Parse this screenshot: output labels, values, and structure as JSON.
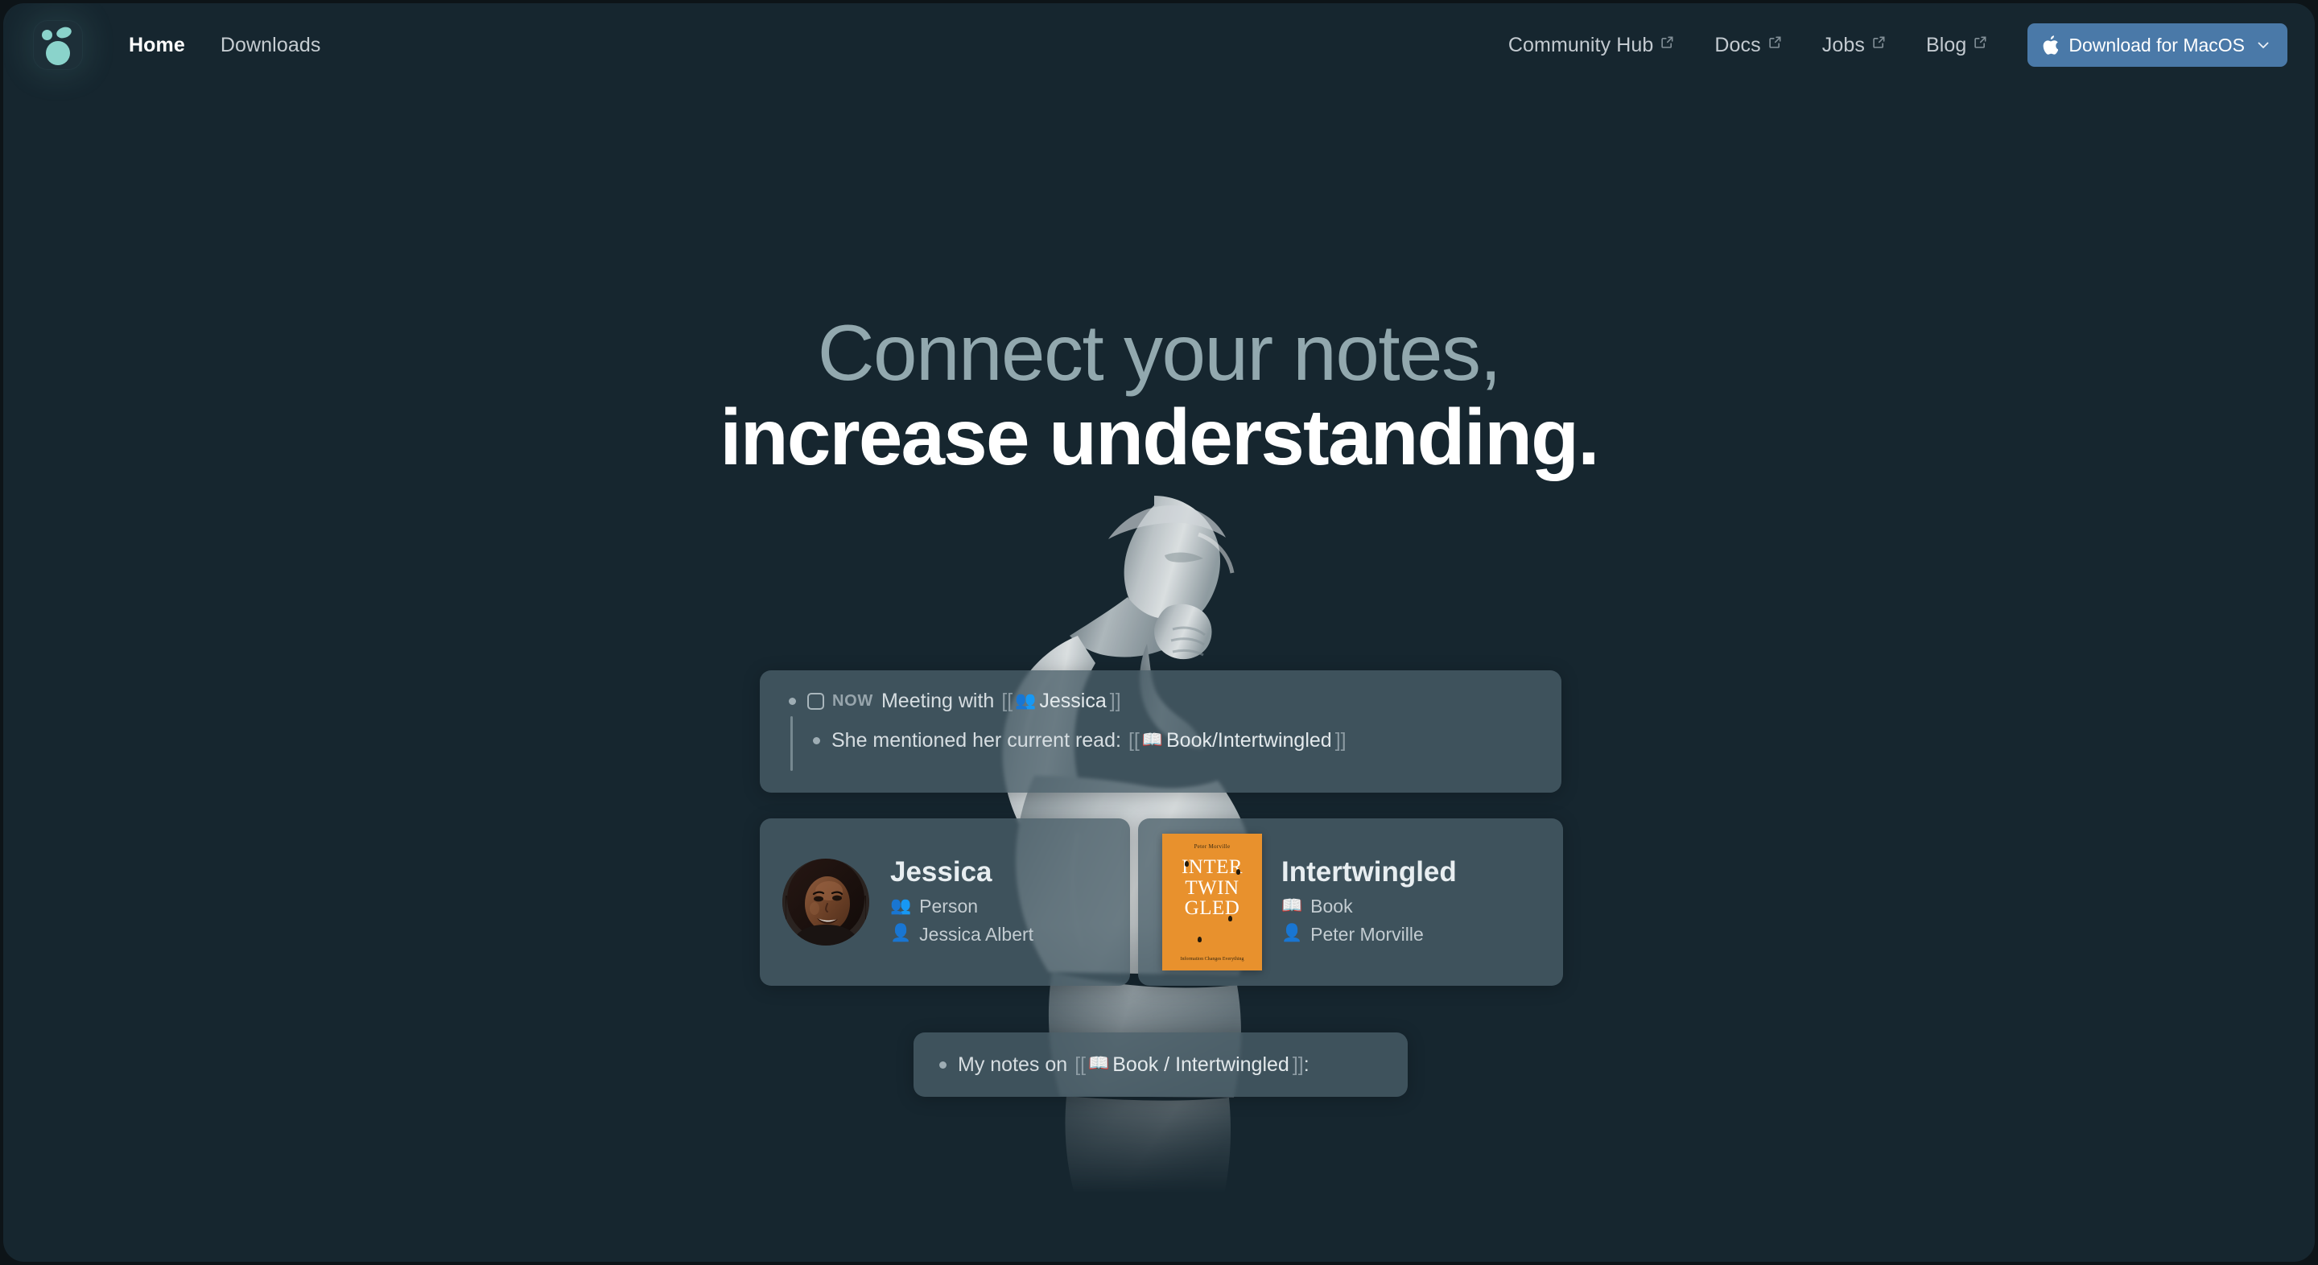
{
  "theme": {
    "background": "#16262f",
    "accent_teal": "#8ad3cb",
    "accent_blue": "#4a79a8",
    "card_bg": "rgba(74,95,105,0.78)",
    "book_orange": "#e8912d",
    "headline_muted": "#92a8ae",
    "headline_bright": "#ffffff"
  },
  "nav": {
    "logo_name": "logseq-logo",
    "left_links": [
      {
        "label": "Home",
        "active": true,
        "external": false
      },
      {
        "label": "Downloads",
        "active": false,
        "external": false
      }
    ],
    "right_links": [
      {
        "label": "Community Hub",
        "external": true
      },
      {
        "label": "Docs",
        "external": true
      },
      {
        "label": "Jobs",
        "external": true
      },
      {
        "label": "Blog",
        "external": true
      }
    ],
    "download_button": {
      "label": "Download for MacOS",
      "platform_icon": "apple-icon",
      "dropdown_icon": "chevron-down-icon"
    }
  },
  "hero": {
    "headline_line1": "Connect your notes,",
    "headline_line2": "increase understanding.",
    "background_image": "the-thinker-statue"
  },
  "journal_card": {
    "row1": {
      "checkbox_checked": false,
      "marker": "NOW",
      "text_before": "Meeting with",
      "link_open": "[[",
      "link_emoji": "👥",
      "link_label": "Jessica",
      "link_close": "]]"
    },
    "row2": {
      "text_before": "She mentioned her current read:",
      "link_open": "[[",
      "link_emoji": "📖",
      "link_label": "Book/Intertwingled",
      "link_close": "]]"
    }
  },
  "person_card": {
    "avatar_name": "jessica-avatar",
    "title": "Jessica",
    "type_emoji": "👥",
    "type_label": "Person",
    "author_emoji": "👤",
    "author_label": "Jessica Albert"
  },
  "book_card": {
    "cover": {
      "author_top": "Peter Morville",
      "title_line1": "INTER",
      "title_line2": "TWIN",
      "title_line3": "GLED",
      "subtitle": "Information Changes Everything"
    },
    "title": "Intertwingled",
    "type_emoji": "📖",
    "type_label": "Book",
    "author_emoji": "👤",
    "author_label": "Peter Morville"
  },
  "notes_card": {
    "text_before": "My notes on",
    "link_open": "[[",
    "link_emoji": "📖",
    "link_label": "Book / Intertwingled",
    "link_close": "]]",
    "text_after": ":"
  }
}
